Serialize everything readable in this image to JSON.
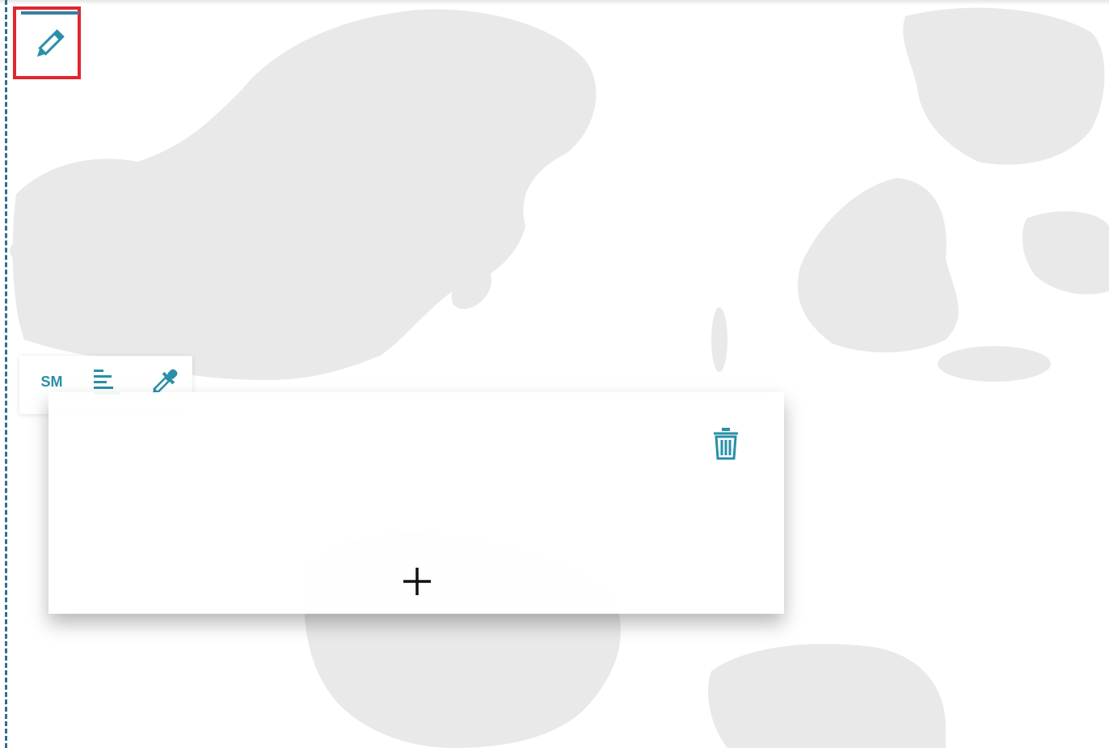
{
  "colors": {
    "accent": "#2a8fa8",
    "highlight_border": "#e0262d",
    "divider": "#2f6f8f",
    "map_land": "#e9e9e9"
  },
  "toolbar": {
    "size_label": "SM",
    "align_icon": "align-left-icon",
    "picker_icon": "eyedropper-icon"
  },
  "edit_tool": {
    "icon": "pencil-icon"
  },
  "card": {
    "delete_icon": "trash-icon",
    "add_icon": "plus-icon"
  }
}
